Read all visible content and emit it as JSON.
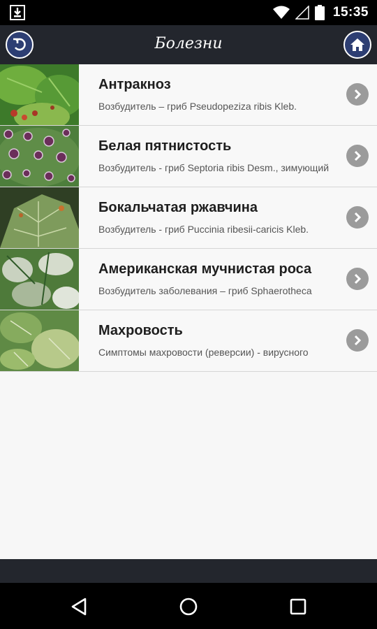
{
  "status_bar": {
    "time": "15:35",
    "icons": [
      "download-icon",
      "wifi-icon",
      "signal-icon",
      "battery-icon"
    ]
  },
  "app_bar": {
    "title": "Болезни",
    "left_icon": "back-icon",
    "right_icon": "home-icon",
    "button_color": "#2d3e73"
  },
  "items": [
    {
      "name": "Антракноз",
      "desc": "Возбудитель – гриб Pseudopeziza ribis Kleb."
    },
    {
      "name": "Белая пятнистость",
      "desc": "Возбудитель - гриб Septoria ribis Desm., зимующий"
    },
    {
      "name": "Бокальчатая ржавчина",
      "desc": "Возбудитель - гриб Puccinia ribesii-caricis Kleb."
    },
    {
      "name": "Американская мучнистая роса",
      "desc": "Возбудитель заболевания – гриб Sphaerotheca"
    },
    {
      "name": "Махровость",
      "desc": "Симптомы махровости (реверсии) - вирусного"
    }
  ],
  "nav_bar": {
    "icons": [
      "nav-back-icon",
      "nav-home-icon",
      "nav-recents-icon"
    ]
  }
}
